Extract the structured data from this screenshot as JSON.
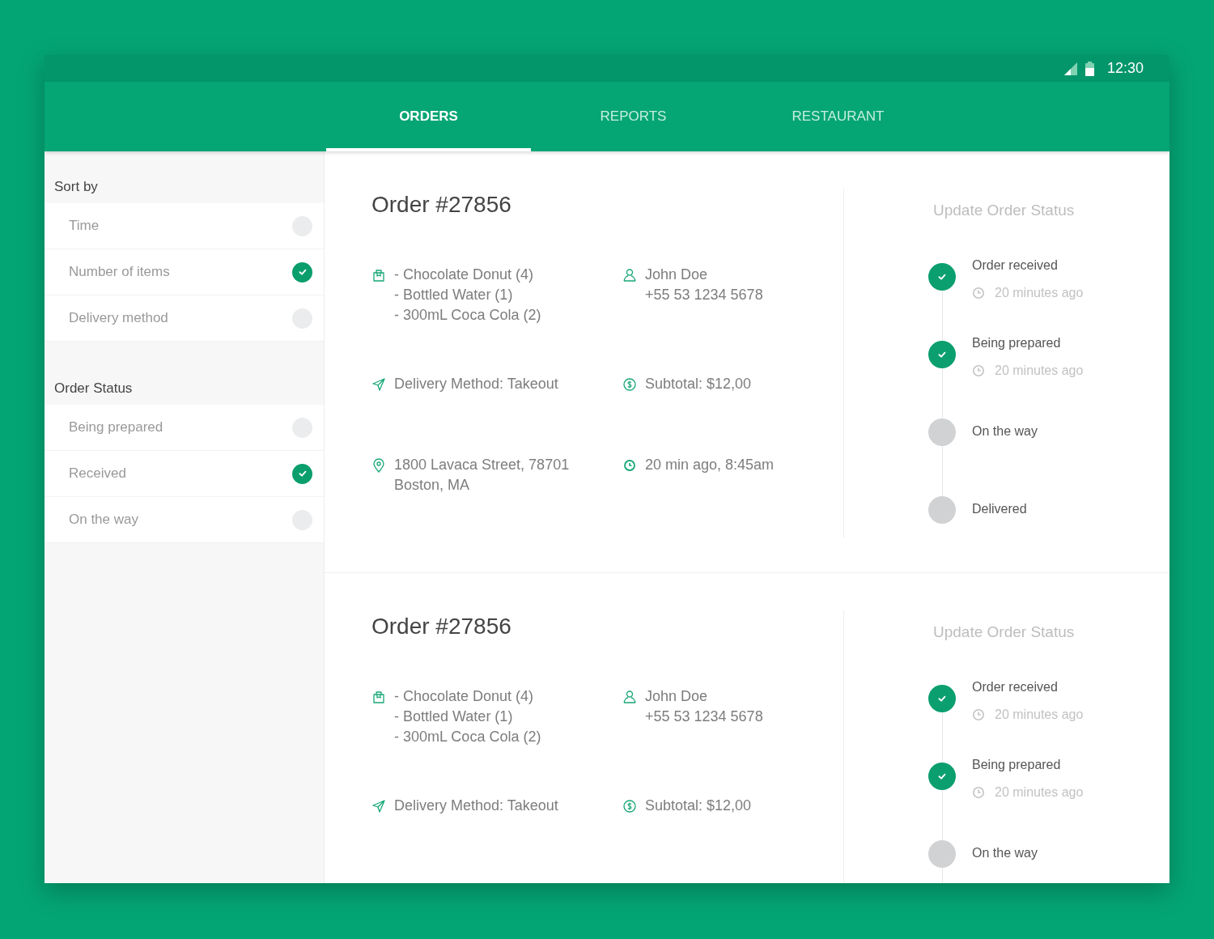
{
  "status_bar": {
    "time": "12:30"
  },
  "tabs": [
    {
      "label": "ORDERS",
      "selected": true
    },
    {
      "label": "REPORTS",
      "selected": false
    },
    {
      "label": "RESTAURANT",
      "selected": false
    }
  ],
  "sidebar": {
    "sections": [
      {
        "title": "Sort by",
        "options": [
          {
            "label": "Time",
            "selected": false
          },
          {
            "label": "Number of items",
            "selected": true
          },
          {
            "label": "Delivery method",
            "selected": false
          }
        ]
      },
      {
        "title": "Order Status",
        "options": [
          {
            "label": "Being prepared",
            "selected": false
          },
          {
            "label": "Received",
            "selected": true
          },
          {
            "label": "On the way",
            "selected": false
          }
        ]
      }
    ]
  },
  "orders": [
    {
      "title": "Order #27856",
      "items": [
        "- Chocolate Donut (4)",
        "- Bottled Water (1)",
        "- 300mL Coca Cola (2)"
      ],
      "customer": {
        "name": "John Doe",
        "phone": "+55 53 1234 5678"
      },
      "delivery": "Delivery Method: Takeout",
      "subtotal": "Subtotal: $12,00",
      "address_lines": [
        "1800 Lavaca Street, 78701",
        "Boston, MA"
      ],
      "time": "20 min ago, 8:45am",
      "status_title": "Update Order Status",
      "steps": [
        {
          "label": "Order received",
          "done": true,
          "time": "20 minutes ago"
        },
        {
          "label": "Being prepared",
          "done": true,
          "time": "20 minutes ago"
        },
        {
          "label": "On the way",
          "done": false
        },
        {
          "label": "Delivered",
          "done": false
        }
      ]
    },
    {
      "title": "Order #27856",
      "items": [
        "- Chocolate Donut (4)",
        "- Bottled Water (1)",
        "- 300mL Coca Cola (2)"
      ],
      "customer": {
        "name": "John Doe",
        "phone": "+55 53 1234 5678"
      },
      "delivery": "Delivery Method: Takeout",
      "subtotal": "Subtotal: $12,00",
      "status_title": "Update Order Status",
      "steps": [
        {
          "label": "Order received",
          "done": true,
          "time": "20 minutes ago"
        },
        {
          "label": "Being prepared",
          "done": true,
          "time": "20 minutes ago"
        },
        {
          "label": "On the way",
          "done": false
        }
      ]
    }
  ]
}
